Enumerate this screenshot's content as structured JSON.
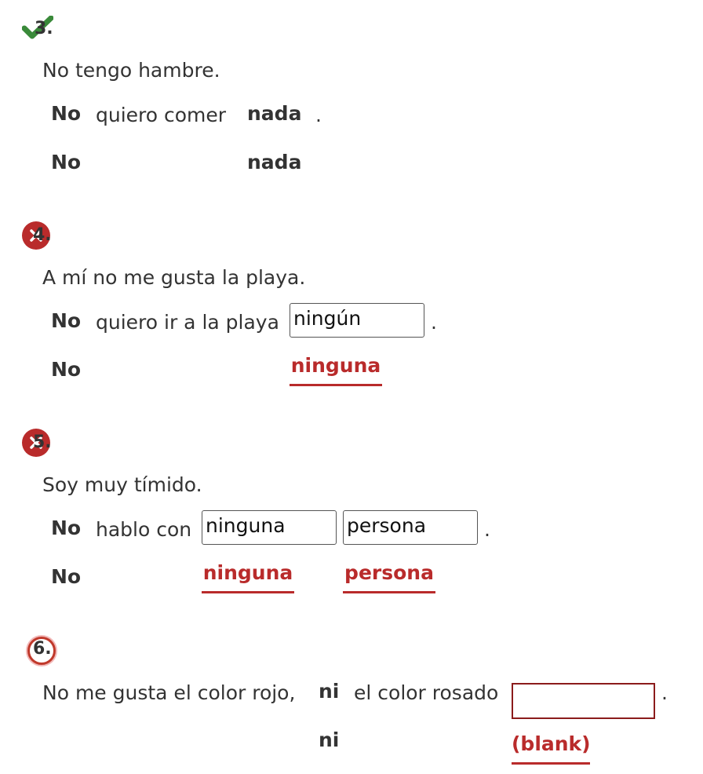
{
  "colors": {
    "correct": "#3a8a3a",
    "incorrect": "#b92b2b",
    "text": "#333333"
  },
  "q3": {
    "number": "3.",
    "prompt": "No tengo hambre.",
    "row1": {
      "w1": "No",
      "w2": "quiero comer",
      "w3": "nada",
      "period": "."
    },
    "row2": {
      "w1": "No",
      "w3": "nada"
    }
  },
  "q4": {
    "number": "4.",
    "prompt": "A mí no me gusta la playa.",
    "row1": {
      "w1": "No",
      "w2": "quiero ir a la playa",
      "input": "ningún",
      "period": "."
    },
    "row2": {
      "w1": "No",
      "answer": "ninguna"
    }
  },
  "q5": {
    "number": "5.",
    "prompt": "Soy muy tímido.",
    "row1": {
      "w1": "No",
      "w2": "hablo con",
      "input1": "ninguna",
      "input2": "persona",
      "period": "."
    },
    "row2": {
      "w1": "No",
      "answer1": "ninguna",
      "answer2": "persona"
    }
  },
  "q6": {
    "number": "6.",
    "row1": {
      "w1": "No me gusta el color rojo,",
      "w2": "ni",
      "w3": "el color rosado",
      "input": "",
      "period": "."
    },
    "row2": {
      "w2": "ni",
      "answer": "(blank)"
    }
  }
}
